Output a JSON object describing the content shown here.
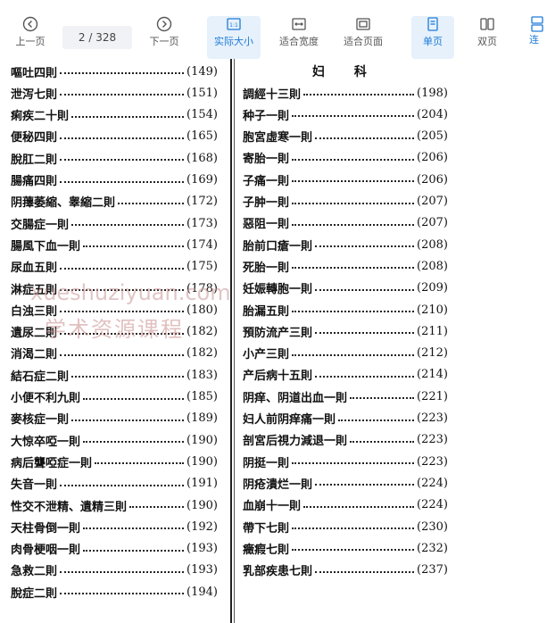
{
  "toolbar": {
    "prev_label": "上一页",
    "page_current": "2",
    "page_total": "/ 328",
    "next_label": "下一页",
    "actual_size_label": "实际大小",
    "fit_width_label": "适合宽度",
    "fit_page_label": "适合页面",
    "single_label": "单页",
    "double_label": "双页",
    "continuous_label": "连"
  },
  "doc": {
    "right_heading": "妇 科",
    "left_entries": [
      {
        "title": "嘔吐四則",
        "page": "(149)"
      },
      {
        "title": "泄泻七則",
        "page": "(151)"
      },
      {
        "title": "痢疾二十則",
        "page": "(154)"
      },
      {
        "title": "便秘四則",
        "page": "(165)"
      },
      {
        "title": "脫肛二則",
        "page": "(168)"
      },
      {
        "title": "腸痛四則",
        "page": "(169)"
      },
      {
        "title": "阴蘀萎縮、睾縮二則",
        "page": "(172)"
      },
      {
        "title": "交腸症一則",
        "page": "(173)"
      },
      {
        "title": "腸風下血一則",
        "page": "(174)"
      },
      {
        "title": "尿血五則",
        "page": "(175)"
      },
      {
        "title": "淋症五則",
        "page": "(178)"
      },
      {
        "title": "白浊三則",
        "page": "(180)"
      },
      {
        "title": "遺尿二則",
        "page": "(182)"
      },
      {
        "title": "消渴二則",
        "page": "(182)"
      },
      {
        "title": "結石症二則",
        "page": "(183)"
      },
      {
        "title": "小便不利九則",
        "page": "(185)"
      },
      {
        "title": "麥核症一則",
        "page": "(189)"
      },
      {
        "title": "大惊卒啞一則",
        "page": "(190)"
      },
      {
        "title": "病后聾啞症一則",
        "page": "(190)"
      },
      {
        "title": "失音一則",
        "page": "(191)"
      },
      {
        "title": "性交不泄精、遺精三則",
        "page": "(190)"
      },
      {
        "title": "天柱骨倒一則",
        "page": "(192)"
      },
      {
        "title": "肉骨梗咽一則",
        "page": "(193)"
      },
      {
        "title": "急救二則",
        "page": "(193)"
      },
      {
        "title": "脫症二則",
        "page": "(194)"
      }
    ],
    "right_entries": [
      {
        "title": "調經十三則",
        "page": "(198)"
      },
      {
        "title": "种子一則",
        "page": "(204)"
      },
      {
        "title": "胞宮虛寒一則",
        "page": "(205)"
      },
      {
        "title": "寄胎一則",
        "page": "(206)"
      },
      {
        "title": "子痛一則",
        "page": "(206)"
      },
      {
        "title": "子肿一則",
        "page": "(207)"
      },
      {
        "title": "惡阻一則",
        "page": "(207)"
      },
      {
        "title": "胎前口瘡一則",
        "page": "(208)"
      },
      {
        "title": "死胎一則",
        "page": "(208)"
      },
      {
        "title": "妊娠轉胞一則",
        "page": "(209)"
      },
      {
        "title": "胎漏五則",
        "page": "(210)"
      },
      {
        "title": "預防流产三則",
        "page": "(211)"
      },
      {
        "title": "小产三則",
        "page": "(212)"
      },
      {
        "title": "产后病十五則",
        "page": "(214)"
      },
      {
        "title": "阴痒、阴道出血一則",
        "page": "(221)"
      },
      {
        "title": "妇人前阴痒痛一則",
        "page": "(223)"
      },
      {
        "title": "剖宮后視力減退一則",
        "page": "(223)"
      },
      {
        "title": "阴挺一則",
        "page": "(223)"
      },
      {
        "title": "阴疮潰烂一則",
        "page": "(224)"
      },
      {
        "title": "血崩十一則",
        "page": "(224)"
      },
      {
        "title": "帶下七則",
        "page": "(230)"
      },
      {
        "title": "癥瘕七則",
        "page": "(232)"
      },
      {
        "title": "乳部疾患七則",
        "page": "(237)"
      }
    ],
    "watermark_line1": "xueshuziyuan.com",
    "watermark_line2": "学术资源课程"
  },
  "colors": {
    "accent": "#1f7ad8",
    "active_bg": "#e6f1fb"
  }
}
